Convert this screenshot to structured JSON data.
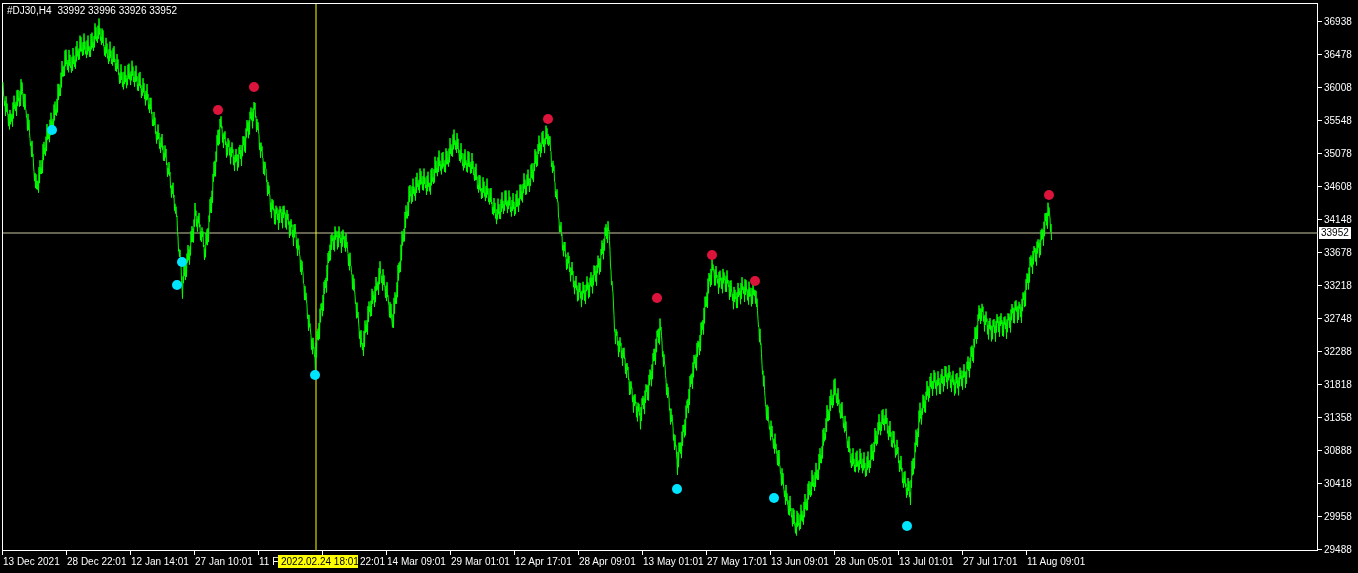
{
  "chart": {
    "symbol": "#DJ30,H4",
    "ohlc": [
      "33992",
      "33996",
      "33926",
      "33952"
    ]
  },
  "price_axis": [
    "36938",
    "36478",
    "36008",
    "35548",
    "35078",
    "34608",
    "34148",
    "33678",
    "33218",
    "32748",
    "32288",
    "31818",
    "31358",
    "30888",
    "30418",
    "29958",
    "29488"
  ],
  "current_price": "33952",
  "time_axis": {
    "before_crosshair": [
      "13 Dec 2021",
      "28 Dec 22:01",
      "12 Jan 14:01",
      "27 Jan 10:01",
      "11 F"
    ],
    "crosshair_time": "2022.02.24 18:01",
    "after_crosshair": [
      "22:01",
      "14 Mar 09:01",
      "29 Mar 01:01",
      "12 Apr 17:01",
      "28 Apr 09:01",
      "13 May 01:01",
      "27 May 17:01",
      "13 Jun 09:01",
      "28 Jun 05:01",
      "13 Jul 01:01",
      "27 Jul 17:01",
      "11 Aug 09:01"
    ]
  }
}
